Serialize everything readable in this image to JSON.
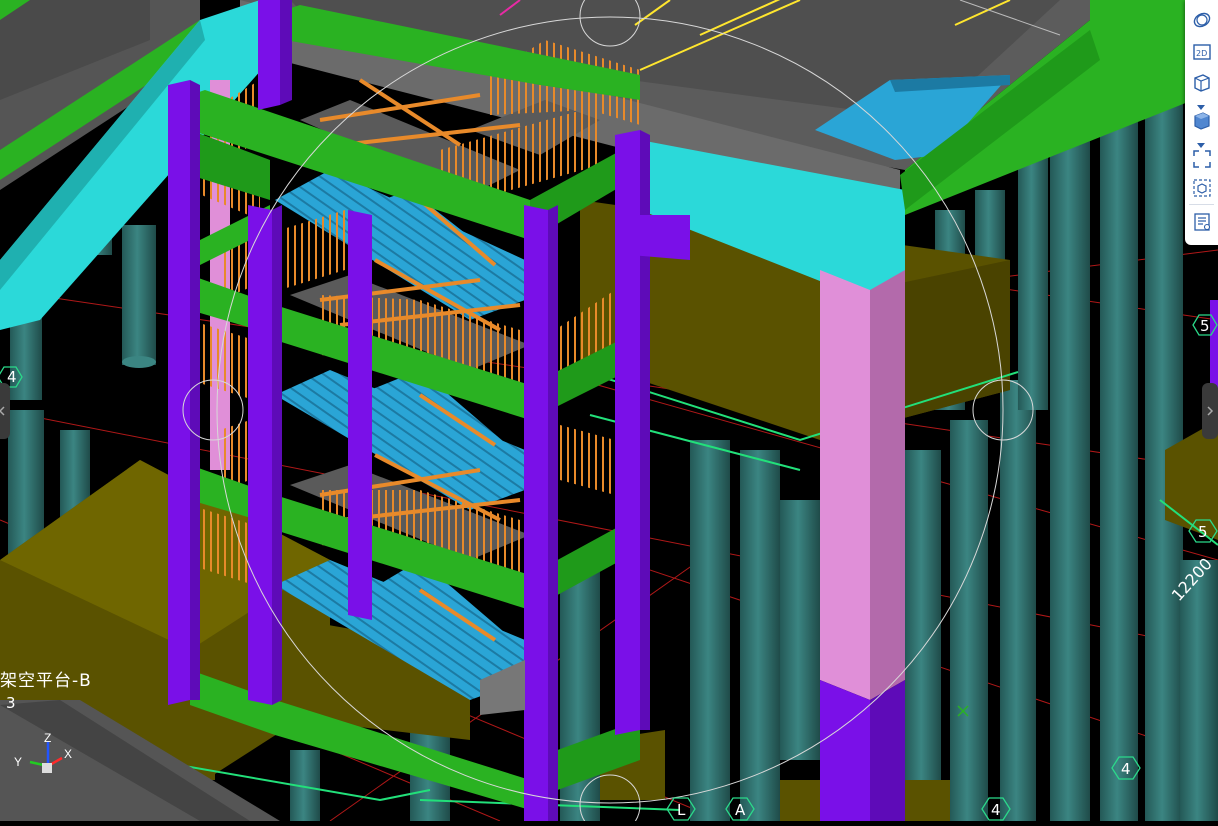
{
  "viewport": {
    "level_label": "架空平台-B",
    "dimension_text": "12200",
    "grid_labels": {
      "left_4": "4",
      "right_5": "5",
      "right_5b": "5",
      "bottom_l": "L",
      "bottom_a": "A",
      "bottom_4": "4",
      "bottom_4b": "4",
      "left_partial": "3"
    },
    "axis": {
      "x": "X",
      "y": "Y",
      "z": "Z"
    }
  },
  "toolbar": {
    "buttons": [
      {
        "name": "orbit-icon"
      },
      {
        "name": "2d-view-icon",
        "text": "2D"
      },
      {
        "name": "3d-box-view-icon"
      },
      {
        "name": "shaded-view-icon"
      },
      {
        "name": "fit-view-icon"
      },
      {
        "name": "section-box-icon"
      },
      {
        "name": "properties-panel-icon"
      }
    ]
  },
  "colors": {
    "background": "#000000",
    "beam_green": "#2ab222",
    "column_purple": "#7a10e8",
    "stair_blue": "#2aa5d6",
    "rail_orange": "#e88a2a",
    "slab_gray": "#6b6b6b",
    "cyan_beam": "#2bd9d9",
    "pink_column": "#e08fd8",
    "pile_teal": "#2f6f6d",
    "pile_cap_olive": "#5a5200",
    "grid_line_red": "#b01818",
    "grid_bubble": "#2bd98a"
  }
}
